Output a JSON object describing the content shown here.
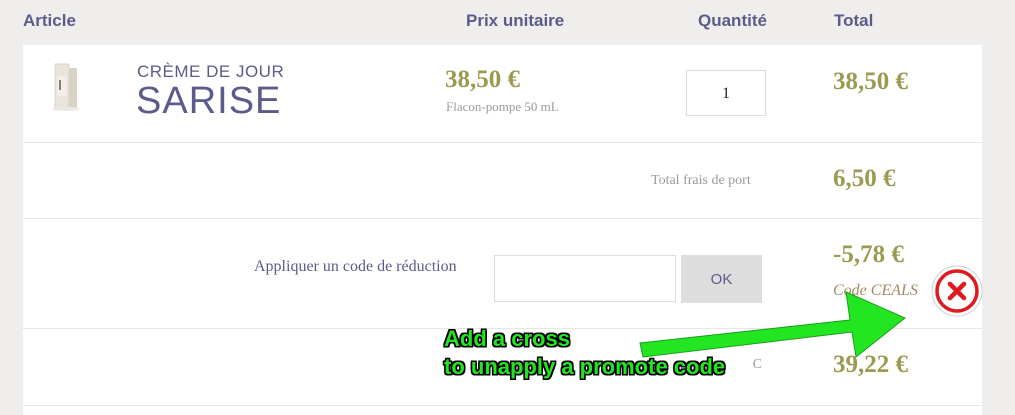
{
  "headers": {
    "article": "Article",
    "unit_price": "Prix unitaire",
    "quantity": "Quantité",
    "total": "Total"
  },
  "product": {
    "line1": "CRÈME DE JOUR",
    "line2": "SARISE",
    "unit_price": "38,50 €",
    "format": "Flacon-pompe 50 mL",
    "quantity": "1",
    "total": "38,50 €"
  },
  "shipping": {
    "label": "Total frais de port",
    "value": "6,50 €"
  },
  "coupon": {
    "label": "Appliquer un code de réduction",
    "input_value": "",
    "ok_label": "OK",
    "discount": "-5,78 €",
    "code_text": "Code CEALS"
  },
  "grand_total": {
    "label_visible": "C",
    "value": "39,22 €"
  },
  "annotation": {
    "line1": "Add a cross",
    "line2": "to unapply a promote code"
  },
  "colors": {
    "accent": "#5b5b8c",
    "price": "#9a9a50",
    "annotation": "#22e622",
    "remove": "#e0191f"
  },
  "icons": {
    "remove": "close-x-circle-icon",
    "product": "product-bottle-icon"
  }
}
